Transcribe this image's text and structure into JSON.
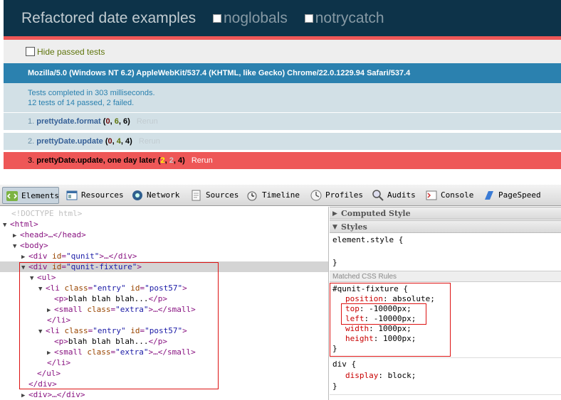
{
  "qunit": {
    "title": "Refactored date examples",
    "checkbox_noglobals": "noglobals",
    "checkbox_notrycatch": "notrycatch",
    "hide_passed": "Hide passed tests",
    "user_agent": "Mozilla/5.0 (Windows NT 6.2) AppleWebKit/537.4 (KHTML, like Gecko) Chrome/22.0.1229.94 Safari/537.4",
    "result_line1": "Tests completed in 303 milliseconds.",
    "result_line2": "12 tests of 14 passed, 2 failed.",
    "tests": [
      {
        "num": "1.",
        "name": "prettydate.format",
        "failed": "0",
        "passed": "6",
        "total": "6",
        "rerun": "Rerun",
        "status": "pass"
      },
      {
        "num": "2.",
        "name": "prettyDate.update",
        "failed": "0",
        "passed": "4",
        "total": "4",
        "rerun": "Rerun",
        "status": "pass"
      },
      {
        "num": "3.",
        "name": "prettyDate.update, one day later",
        "failed": "2",
        "passed": "2",
        "total": "4",
        "rerun": "Rerun",
        "status": "fail"
      }
    ],
    "colors": {
      "header": "#0d3349",
      "fail": "#ee5757",
      "ua": "#2b81af",
      "result": "#d2e0e6"
    }
  },
  "devtools": {
    "tabs": [
      "Elements",
      "Resources",
      "Network",
      "Sources",
      "Timeline",
      "Profiles",
      "Audits",
      "Console",
      "PageSpeed"
    ],
    "dom": {
      "doctype": "<!DOCTYPE html>",
      "html": "<html>",
      "head": "<head>…</head>",
      "body": "<body>",
      "div_qunit_tag": "<div",
      "div_qunit_attr": "id",
      "div_qunit_val": "\"qunit\"",
      "div_qunit_end": ">…</div>",
      "fixture_open_tag": "<div",
      "fixture_attr": "id",
      "fixture_val": "\"qunit-fixture\"",
      "fixture_close": ">",
      "ul_open": "<ul>",
      "li_tag": "<li",
      "li_class_attr": "class",
      "li_class_val": "\"entry\"",
      "li_id_attr": "id",
      "li_id_val": "\"post57\"",
      "gt": ">",
      "p_open": "<p>",
      "p_text": "blah blah blah...",
      "p_close": "</p>",
      "small_tag": "<small",
      "small_class_attr": "class",
      "small_class_val": "\"extra\"",
      "small_end": ">…</small>",
      "li_close": "</li>",
      "ul_close": "</ul>",
      "div_close": "</div>",
      "div_collapsed": "<div>…</div>"
    },
    "styles": {
      "computed_header": "Computed Style",
      "styles_header": "Styles",
      "element_style": "element.style {",
      "close_brace": "}",
      "matched_rules": "Matched CSS Rules",
      "fixture_selector": "#qunit-fixture {",
      "props": [
        {
          "name": "position",
          "value": "absolute;"
        },
        {
          "name": "top",
          "value": "-10000px;"
        },
        {
          "name": "left",
          "value": "-10000px;"
        },
        {
          "name": "width",
          "value": "1000px;"
        },
        {
          "name": "height",
          "value": "1000px;"
        }
      ],
      "div_selector": "div {",
      "div_prop": {
        "name": "display",
        "value": "block;"
      }
    }
  }
}
